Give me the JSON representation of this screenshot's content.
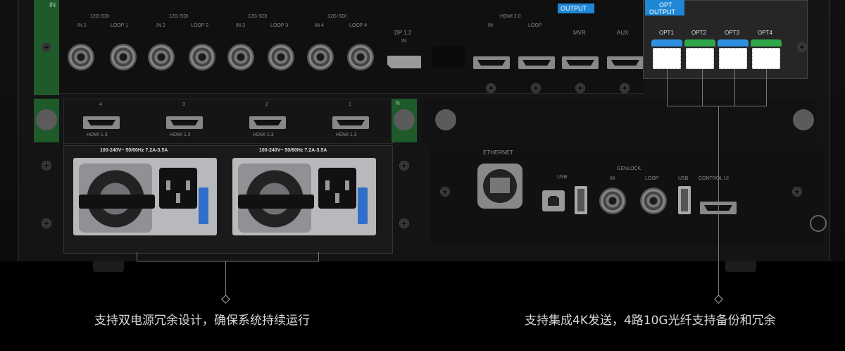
{
  "sdi": {
    "group_label": "12G-SDI",
    "groups": [
      {
        "in": "IN 1",
        "loop": "LOOP 1"
      },
      {
        "in": "IN 2",
        "loop": "LOOP 2"
      },
      {
        "in": "IN 3",
        "loop": "LOOP 3"
      },
      {
        "in": "IN 4",
        "loop": "LOOP 4"
      }
    ]
  },
  "in_tag": "IN",
  "n_tag": "N",
  "dp": {
    "label": "DP 1.2",
    "in": "IN"
  },
  "hdmi20": {
    "label": "HDMI 2.0",
    "in": "IN",
    "loop": "LOOP"
  },
  "output": {
    "tag": "OUTPUT",
    "mvr": "MVR",
    "aux": "AUX"
  },
  "opt_output": {
    "tag_line1": "OPT",
    "tag_line2": "OUTPUT",
    "ports": [
      "OPT1",
      "OPT2",
      "OPT3",
      "OPT4"
    ],
    "cap_colors": [
      "#2f8ee0",
      "#2ea84a",
      "#2f8ee0",
      "#2ea84a"
    ]
  },
  "hdmi13": {
    "ports": [
      {
        "num": "4",
        "label": "HDMI 1.3"
      },
      {
        "num": "3",
        "label": "HDMI 1.3"
      },
      {
        "num": "2",
        "label": "HDMI 1.3"
      },
      {
        "num": "1",
        "label": "HDMI 1.3"
      }
    ]
  },
  "psu": {
    "rating": "100-240V~ 50/60Hz  7.2A-3.5A"
  },
  "control": {
    "ethernet": "ETHERNET",
    "usb": "USB",
    "genlock": "GENLOCK",
    "genlock_in": "IN",
    "genlock_loop": "LOOP",
    "usb2": "USB",
    "control_ui": "CONTROL UI"
  },
  "captions": {
    "left": "支持双电源冗余设计，确保系统持续运行",
    "right": "支持集成4K发送，4路10G光纤支持备份和冗余"
  },
  "colors": {
    "accent_blue": "#1f87d6",
    "latch_blue": "#2f6ec9",
    "module_green": "#1f5a2a"
  }
}
